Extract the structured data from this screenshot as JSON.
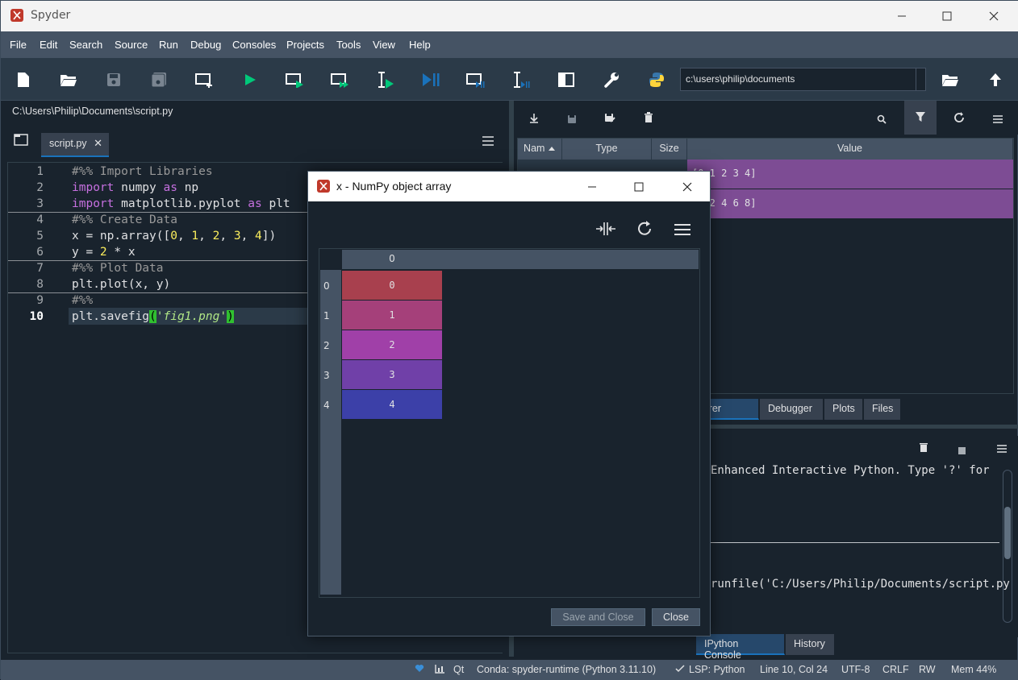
{
  "window": {
    "title": "Spyder"
  },
  "menu": [
    "File",
    "Edit",
    "Search",
    "Source",
    "Run",
    "Debug",
    "Consoles",
    "Projects",
    "Tools",
    "View",
    "Help"
  ],
  "toolbar": {
    "working_dir": "c:\\users\\philip\\documents"
  },
  "editor": {
    "path": "C:\\Users\\Philip\\Documents\\script.py",
    "tab_label": "script.py",
    "close_glyph": "✕",
    "line_numbers": [
      "1",
      "2",
      "3",
      "4",
      "5",
      "6",
      "7",
      "8",
      "9",
      "10"
    ]
  },
  "variable_explorer": {
    "headers": {
      "name": "Nam",
      "type": "Type",
      "size": "Size",
      "value": "Value"
    },
    "rows": [
      {
        "value": "[0 1 2 3 4]"
      },
      {
        "value": "[0 2 4 6 8]"
      }
    ]
  },
  "pane_tabs": [
    "Variable Explorer",
    "Debugger",
    "Plots",
    "Files"
  ],
  "console": {
    "line1": "Enhanced Interactive Python. Type '?' for",
    "line2": "runfile('C:/Users/Philip/Documents/script.py --wdir",
    "tabs": [
      "IPython Console",
      "History"
    ]
  },
  "statusbar": {
    "qt": "Qt",
    "conda": "Conda: spyder-runtime (Python 3.11.10)",
    "lsp": "LSP: Python",
    "position": "Line 10, Col 24",
    "encoding": "UTF-8",
    "eol": "CRLF",
    "rw": "RW",
    "mem": "Mem 44%"
  },
  "dialog": {
    "title": "x - NumPy object array",
    "column_header": "0",
    "indices": [
      "0",
      "1",
      "2",
      "3",
      "4"
    ],
    "values": [
      "0",
      "1",
      "2",
      "3",
      "4"
    ],
    "cell_colors": [
      "#a8404e",
      "#a5407a",
      "#a040a8",
      "#7040a8",
      "#3c40a8"
    ],
    "save_close_label": "Save and Close",
    "close_label": "Close"
  }
}
